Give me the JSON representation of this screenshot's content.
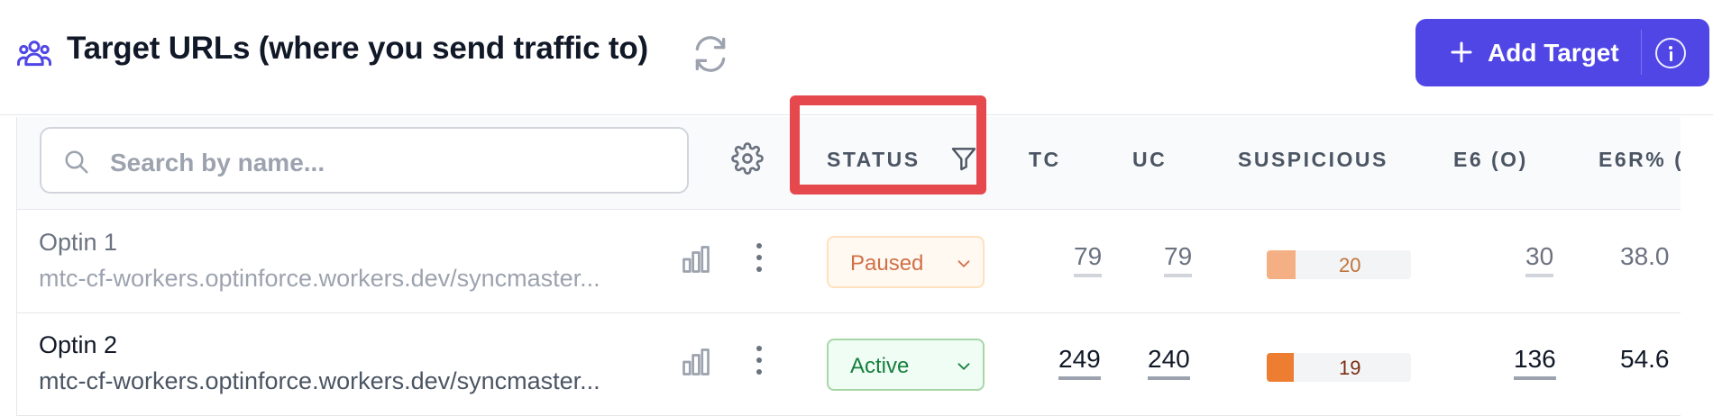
{
  "header": {
    "title": "Target URLs (where you send traffic to)",
    "icon": "users-icon",
    "refresh_icon": "refresh-icon",
    "add_button": {
      "label": "Add Target",
      "icon": "plus-icon",
      "info_icon": "info-icon"
    },
    "accent": "#4f46e5"
  },
  "table": {
    "search_placeholder": "Search by name...",
    "columns": {
      "status": "STATUS",
      "tc": "TC",
      "uc": "UC",
      "suspicious": "SUSPICIOUS",
      "e6": "E6 (O)",
      "e6r": "E6R% ("
    },
    "rows": [
      {
        "name": "Optin 1",
        "url": "mtc-cf-workers.optinforce.workers.dev/syncmaster...",
        "status": "Paused",
        "tc": "79",
        "uc": "79",
        "suspicious": "20",
        "suspicious_fraction": 0.2,
        "suspicious_color": "#f4b084",
        "e6": "30",
        "e6r": "38.0"
      },
      {
        "name": "Optin 2",
        "url": "mtc-cf-workers.optinforce.workers.dev/syncmaster...",
        "status": "Active",
        "tc": "249",
        "uc": "240",
        "suspicious": "19",
        "suspicious_fraction": 0.19,
        "suspicious_color": "#ed7d31",
        "e6": "136",
        "e6r": "54.6"
      }
    ]
  },
  "highlight_color": "#e5484d"
}
